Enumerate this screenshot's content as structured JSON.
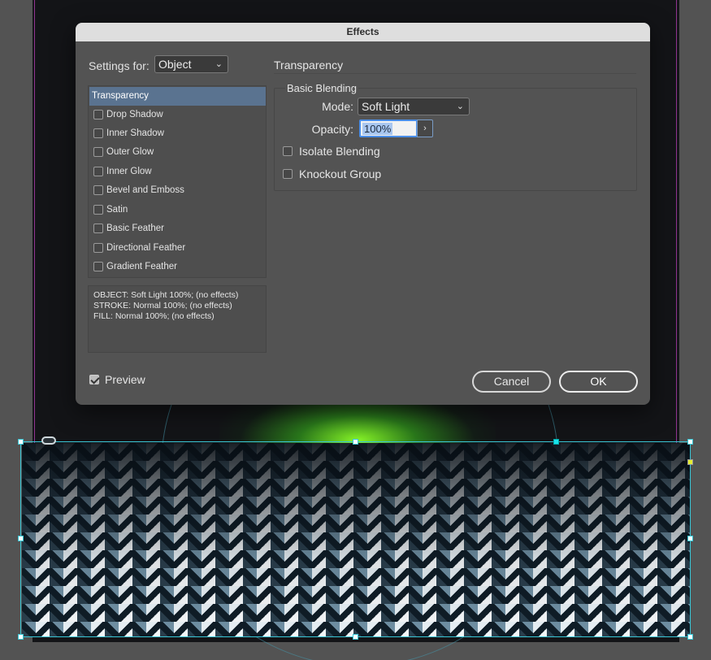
{
  "dialog": {
    "title": "Effects",
    "settings_for_label": "Settings for:",
    "settings_for_value": "Object",
    "effects": [
      {
        "label": "Transparency",
        "selected": true,
        "checkbox": false
      },
      {
        "label": "Drop Shadow",
        "checked": false
      },
      {
        "label": "Inner Shadow",
        "checked": false
      },
      {
        "label": "Outer Glow",
        "checked": false
      },
      {
        "label": "Inner Glow",
        "checked": false
      },
      {
        "label": "Bevel and Emboss",
        "checked": false
      },
      {
        "label": "Satin",
        "checked": false
      },
      {
        "label": "Basic Feather",
        "checked": false
      },
      {
        "label": "Directional Feather",
        "checked": false
      },
      {
        "label": "Gradient Feather",
        "checked": false
      }
    ],
    "summary": [
      "OBJECT: Soft Light 100%; (no effects)",
      "STROKE: Normal 100%; (no effects)",
      "FILL: Normal 100%; (no effects)"
    ],
    "section_title": "Transparency",
    "group_title": "Basic Blending",
    "mode_label": "Mode:",
    "mode_value": "Soft Light",
    "opacity_label": "Opacity:",
    "opacity_value": "100%",
    "isolate_blending_label": "Isolate Blending",
    "knockout_group_label": "Knockout Group",
    "preview_label": "Preview",
    "preview_checked": true,
    "cancel_label": "Cancel",
    "ok_label": "OK"
  },
  "colors": {
    "selection": "#5a7390",
    "frame_guide": "#38c6d6",
    "margin_guide": "#b23cb0",
    "glow": "#8cff28"
  }
}
